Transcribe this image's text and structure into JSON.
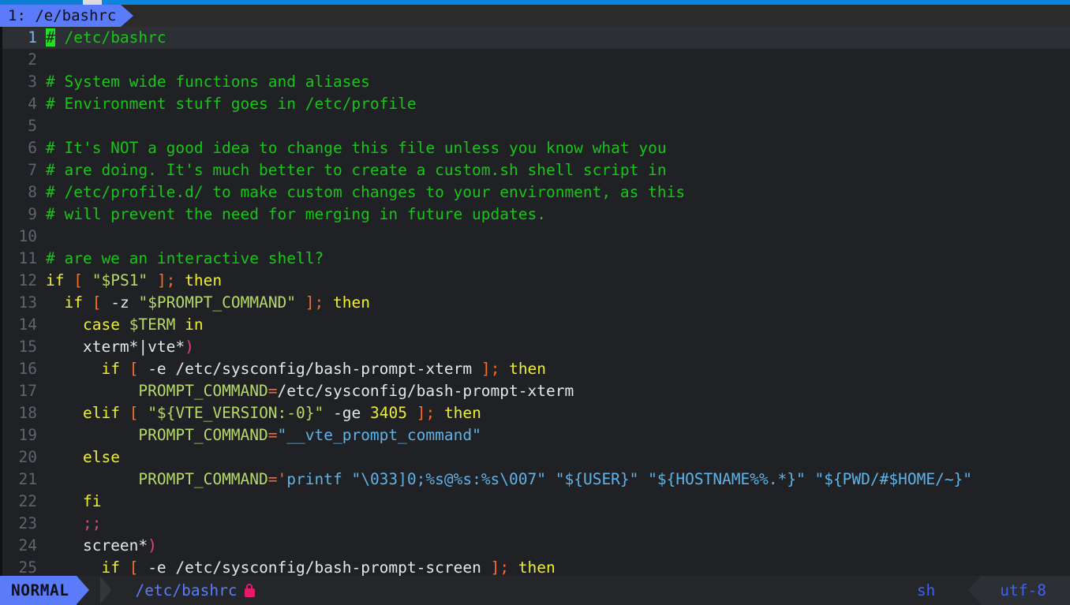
{
  "window": {
    "top_bar_color": "#0b7fd4",
    "accent_color": "#5b7cfa"
  },
  "tabline": {
    "tabs": [
      {
        "label": "1: /e/bashrc",
        "active": true
      }
    ]
  },
  "editor": {
    "filename": "/etc/bashrc",
    "cursor_line": 1,
    "cursor_col": 1,
    "lines": [
      {
        "num": "1",
        "current": true,
        "tokens": [
          {
            "t": "#",
            "c": "cursor"
          },
          {
            "t": " /etc/bashrc",
            "c": "t-comment"
          }
        ]
      },
      {
        "num": "2",
        "current": false,
        "tokens": []
      },
      {
        "num": "3",
        "current": false,
        "tokens": [
          {
            "t": "# System wide functions and aliases",
            "c": "t-comment"
          }
        ]
      },
      {
        "num": "4",
        "current": false,
        "tokens": [
          {
            "t": "# Environment stuff goes in /etc/profile",
            "c": "t-comment"
          }
        ]
      },
      {
        "num": "5",
        "current": false,
        "tokens": []
      },
      {
        "num": "6",
        "current": false,
        "tokens": [
          {
            "t": "# It's NOT a good idea to change this file unless you know what you",
            "c": "t-comment"
          }
        ]
      },
      {
        "num": "7",
        "current": false,
        "tokens": [
          {
            "t": "# are doing. It's much better to create a custom.sh shell script in",
            "c": "t-comment"
          }
        ]
      },
      {
        "num": "8",
        "current": false,
        "tokens": [
          {
            "t": "# /etc/profile.d/ to make custom changes to your environment, as this",
            "c": "t-comment"
          }
        ]
      },
      {
        "num": "9",
        "current": false,
        "tokens": [
          {
            "t": "# will prevent the need for merging in future updates.",
            "c": "t-comment"
          }
        ]
      },
      {
        "num": "10",
        "current": false,
        "tokens": []
      },
      {
        "num": "11",
        "current": false,
        "tokens": [
          {
            "t": "# are we an interactive shell?",
            "c": "t-comment"
          }
        ]
      },
      {
        "num": "12",
        "current": false,
        "tokens": [
          {
            "t": "if",
            "c": "t-keyword"
          },
          {
            "t": " ",
            "c": "t-plain"
          },
          {
            "t": "[",
            "c": "t-bracket"
          },
          {
            "t": " ",
            "c": "t-plain"
          },
          {
            "t": "\"$PS1\"",
            "c": "t-var"
          },
          {
            "t": " ",
            "c": "t-plain"
          },
          {
            "t": "];",
            "c": "t-bracket"
          },
          {
            "t": " ",
            "c": "t-plain"
          },
          {
            "t": "then",
            "c": "t-keyword"
          }
        ]
      },
      {
        "num": "13",
        "current": false,
        "tokens": [
          {
            "t": "  ",
            "c": "t-plain"
          },
          {
            "t": "if",
            "c": "t-keyword"
          },
          {
            "t": " ",
            "c": "t-plain"
          },
          {
            "t": "[",
            "c": "t-bracket"
          },
          {
            "t": " ",
            "c": "t-plain"
          },
          {
            "t": "-z",
            "c": "t-white"
          },
          {
            "t": " ",
            "c": "t-plain"
          },
          {
            "t": "\"$PROMPT_COMMAND\"",
            "c": "t-var"
          },
          {
            "t": " ",
            "c": "t-plain"
          },
          {
            "t": "];",
            "c": "t-bracket"
          },
          {
            "t": " ",
            "c": "t-plain"
          },
          {
            "t": "then",
            "c": "t-keyword"
          }
        ]
      },
      {
        "num": "14",
        "current": false,
        "tokens": [
          {
            "t": "    ",
            "c": "t-plain"
          },
          {
            "t": "case",
            "c": "t-keyword"
          },
          {
            "t": " ",
            "c": "t-plain"
          },
          {
            "t": "$TERM",
            "c": "t-var"
          },
          {
            "t": " ",
            "c": "t-plain"
          },
          {
            "t": "in",
            "c": "t-keyword"
          }
        ]
      },
      {
        "num": "15",
        "current": false,
        "tokens": [
          {
            "t": "    ",
            "c": "t-plain"
          },
          {
            "t": "xterm*|vte*",
            "c": "t-white"
          },
          {
            "t": ")",
            "c": "t-delim"
          }
        ]
      },
      {
        "num": "16",
        "current": false,
        "tokens": [
          {
            "t": "      ",
            "c": "t-plain"
          },
          {
            "t": "if",
            "c": "t-keyword"
          },
          {
            "t": " ",
            "c": "t-plain"
          },
          {
            "t": "[",
            "c": "t-bracket"
          },
          {
            "t": " ",
            "c": "t-plain"
          },
          {
            "t": "-e /etc/sysconfig/bash-prompt-xterm",
            "c": "t-white"
          },
          {
            "t": " ",
            "c": "t-plain"
          },
          {
            "t": "];",
            "c": "t-bracket"
          },
          {
            "t": " ",
            "c": "t-plain"
          },
          {
            "t": "then",
            "c": "t-keyword"
          }
        ]
      },
      {
        "num": "17",
        "current": false,
        "tokens": [
          {
            "t": "          ",
            "c": "t-plain"
          },
          {
            "t": "PROMPT_COMMAND",
            "c": "t-var"
          },
          {
            "t": "=",
            "c": "t-operator"
          },
          {
            "t": "/etc/sysconfig/bash-prompt-xterm",
            "c": "t-white"
          }
        ]
      },
      {
        "num": "18",
        "current": false,
        "tokens": [
          {
            "t": "    ",
            "c": "t-plain"
          },
          {
            "t": "elif",
            "c": "t-keyword"
          },
          {
            "t": " ",
            "c": "t-plain"
          },
          {
            "t": "[",
            "c": "t-bracket"
          },
          {
            "t": " ",
            "c": "t-plain"
          },
          {
            "t": "\"${VTE_VERSION:-0}\"",
            "c": "t-var"
          },
          {
            "t": " ",
            "c": "t-plain"
          },
          {
            "t": "-ge",
            "c": "t-white"
          },
          {
            "t": " ",
            "c": "t-plain"
          },
          {
            "t": "3405",
            "c": "t-number"
          },
          {
            "t": " ",
            "c": "t-plain"
          },
          {
            "t": "];",
            "c": "t-bracket"
          },
          {
            "t": " ",
            "c": "t-plain"
          },
          {
            "t": "then",
            "c": "t-keyword"
          }
        ]
      },
      {
        "num": "19",
        "current": false,
        "tokens": [
          {
            "t": "          ",
            "c": "t-plain"
          },
          {
            "t": "PROMPT_COMMAND",
            "c": "t-var"
          },
          {
            "t": "=",
            "c": "t-operator"
          },
          {
            "t": "\"__vte_prompt_command\"",
            "c": "t-string"
          }
        ]
      },
      {
        "num": "20",
        "current": false,
        "tokens": [
          {
            "t": "    ",
            "c": "t-plain"
          },
          {
            "t": "else",
            "c": "t-keyword"
          }
        ]
      },
      {
        "num": "21",
        "current": false,
        "tokens": [
          {
            "t": "          ",
            "c": "t-plain"
          },
          {
            "t": "PROMPT_COMMAND",
            "c": "t-var"
          },
          {
            "t": "=",
            "c": "t-operator"
          },
          {
            "t": "'",
            "c": "t-operator"
          },
          {
            "t": "printf \"\\033]0;%s@%s:%s\\007\" \"${USER}\" \"${HOSTNAME%%.*}\" \"${PWD/#$HOME/~}\"",
            "c": "t-string"
          }
        ]
      },
      {
        "num": "22",
        "current": false,
        "tokens": [
          {
            "t": "    ",
            "c": "t-plain"
          },
          {
            "t": "fi",
            "c": "t-keyword"
          }
        ]
      },
      {
        "num": "23",
        "current": false,
        "tokens": [
          {
            "t": "    ",
            "c": "t-plain"
          },
          {
            "t": ";;",
            "c": "t-delim"
          }
        ]
      },
      {
        "num": "24",
        "current": false,
        "tokens": [
          {
            "t": "    ",
            "c": "t-plain"
          },
          {
            "t": "screen*",
            "c": "t-white"
          },
          {
            "t": ")",
            "c": "t-delim"
          }
        ]
      },
      {
        "num": "25",
        "current": false,
        "tokens": [
          {
            "t": "      ",
            "c": "t-plain"
          },
          {
            "t": "if",
            "c": "t-keyword"
          },
          {
            "t": " ",
            "c": "t-plain"
          },
          {
            "t": "[",
            "c": "t-bracket"
          },
          {
            "t": " ",
            "c": "t-plain"
          },
          {
            "t": "-e /etc/sysconfig/bash-prompt-screen",
            "c": "t-white"
          },
          {
            "t": " ",
            "c": "t-plain"
          },
          {
            "t": "];",
            "c": "t-bracket"
          },
          {
            "t": " ",
            "c": "t-plain"
          },
          {
            "t": "then",
            "c": "t-keyword"
          }
        ]
      }
    ]
  },
  "statusline": {
    "mode": "NORMAL",
    "file_path": "/etc/bashrc",
    "readonly_icon": "lock-icon",
    "filetype": "sh",
    "encoding": "utf-8"
  }
}
